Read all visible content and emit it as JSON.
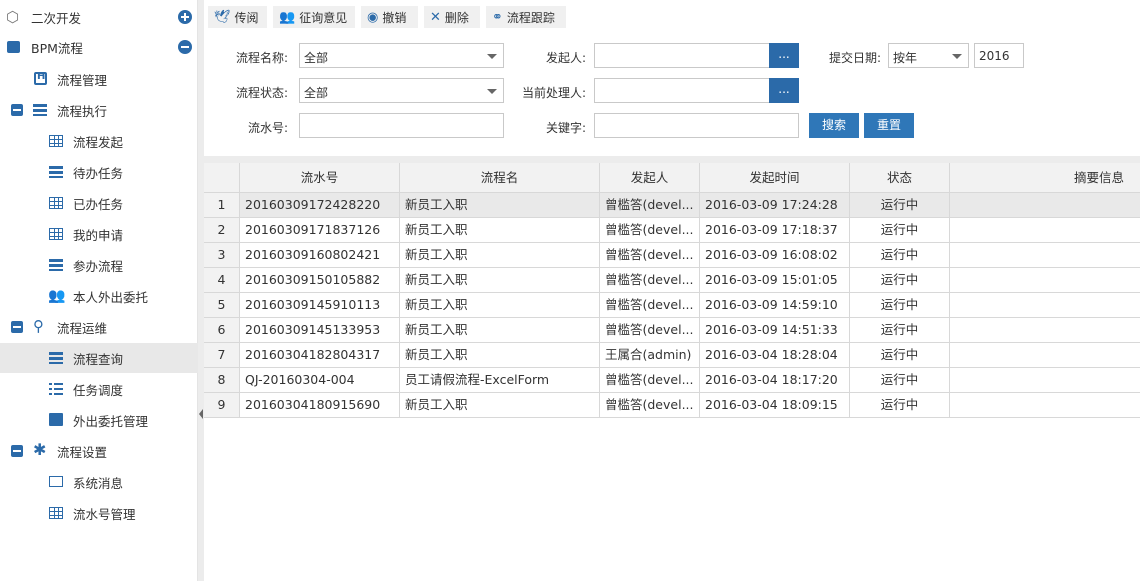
{
  "sidebar": {
    "items": [
      {
        "label": "二次开发"
      },
      {
        "label": "BPM流程"
      },
      {
        "label": "流程管理"
      },
      {
        "label": "流程执行"
      },
      {
        "label": "流程发起"
      },
      {
        "label": "待办任务"
      },
      {
        "label": "已办任务"
      },
      {
        "label": "我的申请"
      },
      {
        "label": "参办流程"
      },
      {
        "label": "本人外出委托"
      },
      {
        "label": "流程运维"
      },
      {
        "label": "流程查询"
      },
      {
        "label": "任务调度"
      },
      {
        "label": "外出委托管理"
      },
      {
        "label": "流程设置"
      },
      {
        "label": "系统消息"
      },
      {
        "label": "流水号管理"
      }
    ]
  },
  "toolbar": {
    "buttons": [
      {
        "label": "传阅",
        "icon": "twitter-icon"
      },
      {
        "label": "征询意见",
        "icon": "users-icon"
      },
      {
        "label": "撤销",
        "icon": "stop-circle-icon"
      },
      {
        "label": "删除",
        "icon": "close-icon"
      },
      {
        "label": "流程跟踪",
        "icon": "sitemap-icon"
      }
    ]
  },
  "form": {
    "process_name_label": "流程名称:",
    "process_name_value": "全部",
    "initiator_label": "发起人:",
    "initiator_value": "",
    "submit_date_label": "提交日期:",
    "submit_date_mode": "按年",
    "submit_date_year": "2016",
    "process_status_label": "流程状态:",
    "process_status_value": "全部",
    "current_handler_label": "当前处理人:",
    "current_handler_value": "",
    "serial_no_label": "流水号:",
    "serial_no_value": "",
    "keyword_label": "关键字:",
    "keyword_value": "",
    "picker_label": "...",
    "search_label": "搜索",
    "reset_label": "重置"
  },
  "table": {
    "columns": [
      "流水号",
      "流程名",
      "发起人",
      "发起时间",
      "状态",
      "摘要信息"
    ],
    "rows": [
      {
        "n": "1",
        "serial": "20160309172428220",
        "name": "新员工入职",
        "initiator": "曾槛答(devel...",
        "time": "2016-03-09 17:24:28",
        "status": "运行中",
        "summary": ""
      },
      {
        "n": "2",
        "serial": "20160309171837126",
        "name": "新员工入职",
        "initiator": "曾槛答(devel...",
        "time": "2016-03-09 17:18:37",
        "status": "运行中",
        "summary": ""
      },
      {
        "n": "3",
        "serial": "20160309160802421",
        "name": "新员工入职",
        "initiator": "曾槛答(devel...",
        "time": "2016-03-09 16:08:02",
        "status": "运行中",
        "summary": ""
      },
      {
        "n": "4",
        "serial": "20160309150105882",
        "name": "新员工入职",
        "initiator": "曾槛答(devel...",
        "time": "2016-03-09 15:01:05",
        "status": "运行中",
        "summary": ""
      },
      {
        "n": "5",
        "serial": "20160309145910113",
        "name": "新员工入职",
        "initiator": "曾槛答(devel...",
        "time": "2016-03-09 14:59:10",
        "status": "运行中",
        "summary": ""
      },
      {
        "n": "6",
        "serial": "20160309145133953",
        "name": "新员工入职",
        "initiator": "曾槛答(devel...",
        "time": "2016-03-09 14:51:33",
        "status": "运行中",
        "summary": ""
      },
      {
        "n": "7",
        "serial": "20160304182804317",
        "name": "新员工入职",
        "initiator": "王属合(admin)",
        "time": "2016-03-04 18:28:04",
        "status": "运行中",
        "summary": ""
      },
      {
        "n": "8",
        "serial": "QJ-20160304-004",
        "name": "员工请假流程-ExcelForm",
        "initiator": "曾槛答(devel...",
        "time": "2016-03-04 18:17:20",
        "status": "运行中",
        "summary": ""
      },
      {
        "n": "9",
        "serial": "20160304180915690",
        "name": "新员工入职",
        "initiator": "曾槛答(devel...",
        "time": "2016-03-04 18:09:15",
        "status": "运行中",
        "summary": ""
      }
    ]
  },
  "colors": {
    "accent": "#2b6aa9",
    "button": "#2f77b8"
  }
}
